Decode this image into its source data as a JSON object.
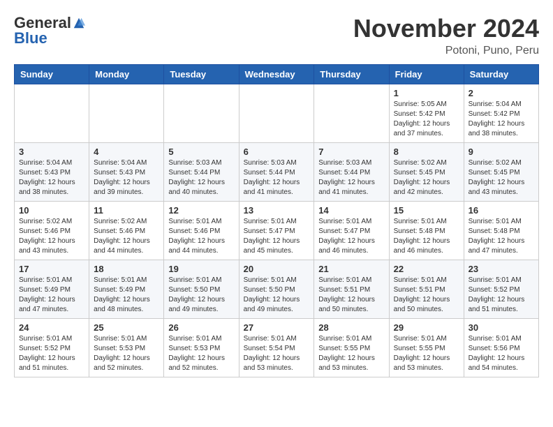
{
  "header": {
    "logo": {
      "general": "General",
      "blue": "Blue"
    },
    "title": "November 2024",
    "location": "Potoni, Puno, Peru"
  },
  "days_of_week": [
    "Sunday",
    "Monday",
    "Tuesday",
    "Wednesday",
    "Thursday",
    "Friday",
    "Saturday"
  ],
  "weeks": [
    [
      {
        "day": "",
        "info": ""
      },
      {
        "day": "",
        "info": ""
      },
      {
        "day": "",
        "info": ""
      },
      {
        "day": "",
        "info": ""
      },
      {
        "day": "",
        "info": ""
      },
      {
        "day": "1",
        "info": "Sunrise: 5:05 AM\nSunset: 5:42 PM\nDaylight: 12 hours and 37 minutes."
      },
      {
        "day": "2",
        "info": "Sunrise: 5:04 AM\nSunset: 5:42 PM\nDaylight: 12 hours and 38 minutes."
      }
    ],
    [
      {
        "day": "3",
        "info": "Sunrise: 5:04 AM\nSunset: 5:43 PM\nDaylight: 12 hours and 38 minutes."
      },
      {
        "day": "4",
        "info": "Sunrise: 5:04 AM\nSunset: 5:43 PM\nDaylight: 12 hours and 39 minutes."
      },
      {
        "day": "5",
        "info": "Sunrise: 5:03 AM\nSunset: 5:44 PM\nDaylight: 12 hours and 40 minutes."
      },
      {
        "day": "6",
        "info": "Sunrise: 5:03 AM\nSunset: 5:44 PM\nDaylight: 12 hours and 41 minutes."
      },
      {
        "day": "7",
        "info": "Sunrise: 5:03 AM\nSunset: 5:44 PM\nDaylight: 12 hours and 41 minutes."
      },
      {
        "day": "8",
        "info": "Sunrise: 5:02 AM\nSunset: 5:45 PM\nDaylight: 12 hours and 42 minutes."
      },
      {
        "day": "9",
        "info": "Sunrise: 5:02 AM\nSunset: 5:45 PM\nDaylight: 12 hours and 43 minutes."
      }
    ],
    [
      {
        "day": "10",
        "info": "Sunrise: 5:02 AM\nSunset: 5:46 PM\nDaylight: 12 hours and 43 minutes."
      },
      {
        "day": "11",
        "info": "Sunrise: 5:02 AM\nSunset: 5:46 PM\nDaylight: 12 hours and 44 minutes."
      },
      {
        "day": "12",
        "info": "Sunrise: 5:01 AM\nSunset: 5:46 PM\nDaylight: 12 hours and 44 minutes."
      },
      {
        "day": "13",
        "info": "Sunrise: 5:01 AM\nSunset: 5:47 PM\nDaylight: 12 hours and 45 minutes."
      },
      {
        "day": "14",
        "info": "Sunrise: 5:01 AM\nSunset: 5:47 PM\nDaylight: 12 hours and 46 minutes."
      },
      {
        "day": "15",
        "info": "Sunrise: 5:01 AM\nSunset: 5:48 PM\nDaylight: 12 hours and 46 minutes."
      },
      {
        "day": "16",
        "info": "Sunrise: 5:01 AM\nSunset: 5:48 PM\nDaylight: 12 hours and 47 minutes."
      }
    ],
    [
      {
        "day": "17",
        "info": "Sunrise: 5:01 AM\nSunset: 5:49 PM\nDaylight: 12 hours and 47 minutes."
      },
      {
        "day": "18",
        "info": "Sunrise: 5:01 AM\nSunset: 5:49 PM\nDaylight: 12 hours and 48 minutes."
      },
      {
        "day": "19",
        "info": "Sunrise: 5:01 AM\nSunset: 5:50 PM\nDaylight: 12 hours and 49 minutes."
      },
      {
        "day": "20",
        "info": "Sunrise: 5:01 AM\nSunset: 5:50 PM\nDaylight: 12 hours and 49 minutes."
      },
      {
        "day": "21",
        "info": "Sunrise: 5:01 AM\nSunset: 5:51 PM\nDaylight: 12 hours and 50 minutes."
      },
      {
        "day": "22",
        "info": "Sunrise: 5:01 AM\nSunset: 5:51 PM\nDaylight: 12 hours and 50 minutes."
      },
      {
        "day": "23",
        "info": "Sunrise: 5:01 AM\nSunset: 5:52 PM\nDaylight: 12 hours and 51 minutes."
      }
    ],
    [
      {
        "day": "24",
        "info": "Sunrise: 5:01 AM\nSunset: 5:52 PM\nDaylight: 12 hours and 51 minutes."
      },
      {
        "day": "25",
        "info": "Sunrise: 5:01 AM\nSunset: 5:53 PM\nDaylight: 12 hours and 52 minutes."
      },
      {
        "day": "26",
        "info": "Sunrise: 5:01 AM\nSunset: 5:53 PM\nDaylight: 12 hours and 52 minutes."
      },
      {
        "day": "27",
        "info": "Sunrise: 5:01 AM\nSunset: 5:54 PM\nDaylight: 12 hours and 53 minutes."
      },
      {
        "day": "28",
        "info": "Sunrise: 5:01 AM\nSunset: 5:55 PM\nDaylight: 12 hours and 53 minutes."
      },
      {
        "day": "29",
        "info": "Sunrise: 5:01 AM\nSunset: 5:55 PM\nDaylight: 12 hours and 53 minutes."
      },
      {
        "day": "30",
        "info": "Sunrise: 5:01 AM\nSunset: 5:56 PM\nDaylight: 12 hours and 54 minutes."
      }
    ]
  ]
}
